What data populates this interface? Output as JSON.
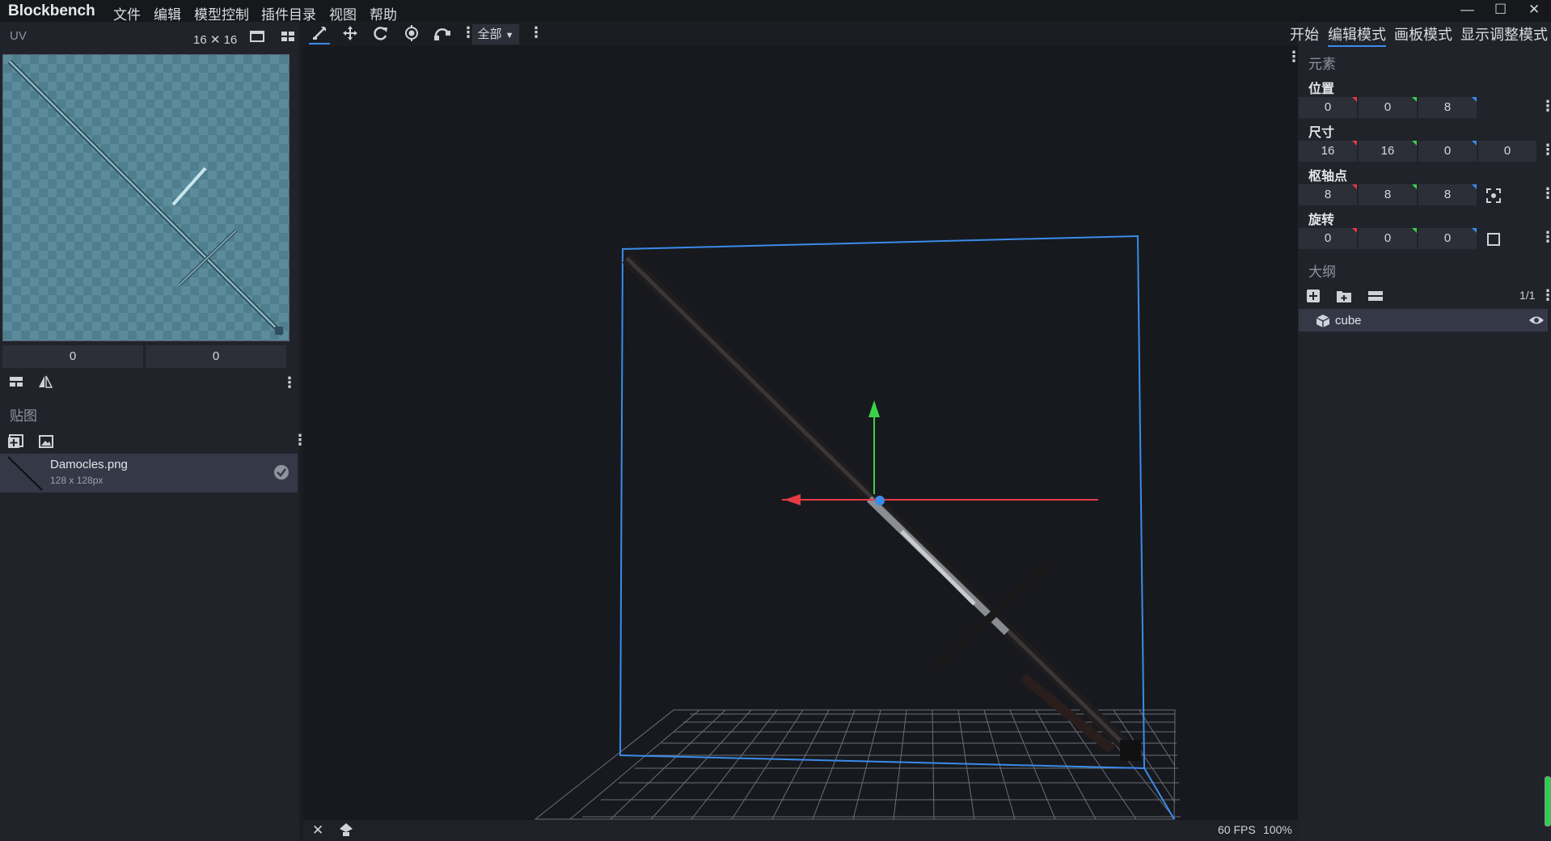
{
  "app": {
    "title": "Blockbench"
  },
  "menu": [
    "文件",
    "编辑",
    "模型控制",
    "插件目录",
    "视图",
    "帮助"
  ],
  "window_controls": {
    "minimize": "—",
    "maximize": "☐",
    "close": "✕"
  },
  "uv_panel": {
    "label": "UV",
    "size": "16 ✕ 16",
    "offset_x": "0",
    "offset_y": "0"
  },
  "textures": {
    "label": "贴图",
    "items": [
      {
        "name": "Damocles.png",
        "size": "128 x 128px"
      }
    ]
  },
  "toolbar": {
    "selection_mode": "全部"
  },
  "status": {
    "fps": "60 FPS",
    "zoom": "100%"
  },
  "modes": [
    "开始",
    "编辑模式",
    "画板模式",
    "显示调整模式"
  ],
  "active_mode": "编辑模式",
  "element_panel": {
    "title": "元素",
    "position": {
      "label": "位置",
      "values": [
        "0",
        "0",
        "8"
      ]
    },
    "size": {
      "label": "尺寸",
      "values": [
        "16",
        "16",
        "0",
        "0"
      ]
    },
    "pivot": {
      "label": "枢轴点",
      "values": [
        "8",
        "8",
        "8"
      ]
    },
    "rotation": {
      "label": "旋转",
      "values": [
        "0",
        "0",
        "0"
      ]
    }
  },
  "outliner": {
    "title": "大纲",
    "count": "1/1",
    "items": [
      {
        "name": "cube"
      }
    ]
  },
  "axis_colors": {
    "x": "#e53b44",
    "y": "#3bd14a",
    "z": "#3b8bea"
  },
  "icons": [
    "uv-icon",
    "grid-icon",
    "move-icon",
    "resize-icon",
    "rotate-icon",
    "pivot-icon",
    "vertex-icon",
    "add-cube-icon",
    "add-group-icon",
    "collapse-icon",
    "eye-icon",
    "cube-icon",
    "checkmark-icon",
    "focus-icon"
  ]
}
